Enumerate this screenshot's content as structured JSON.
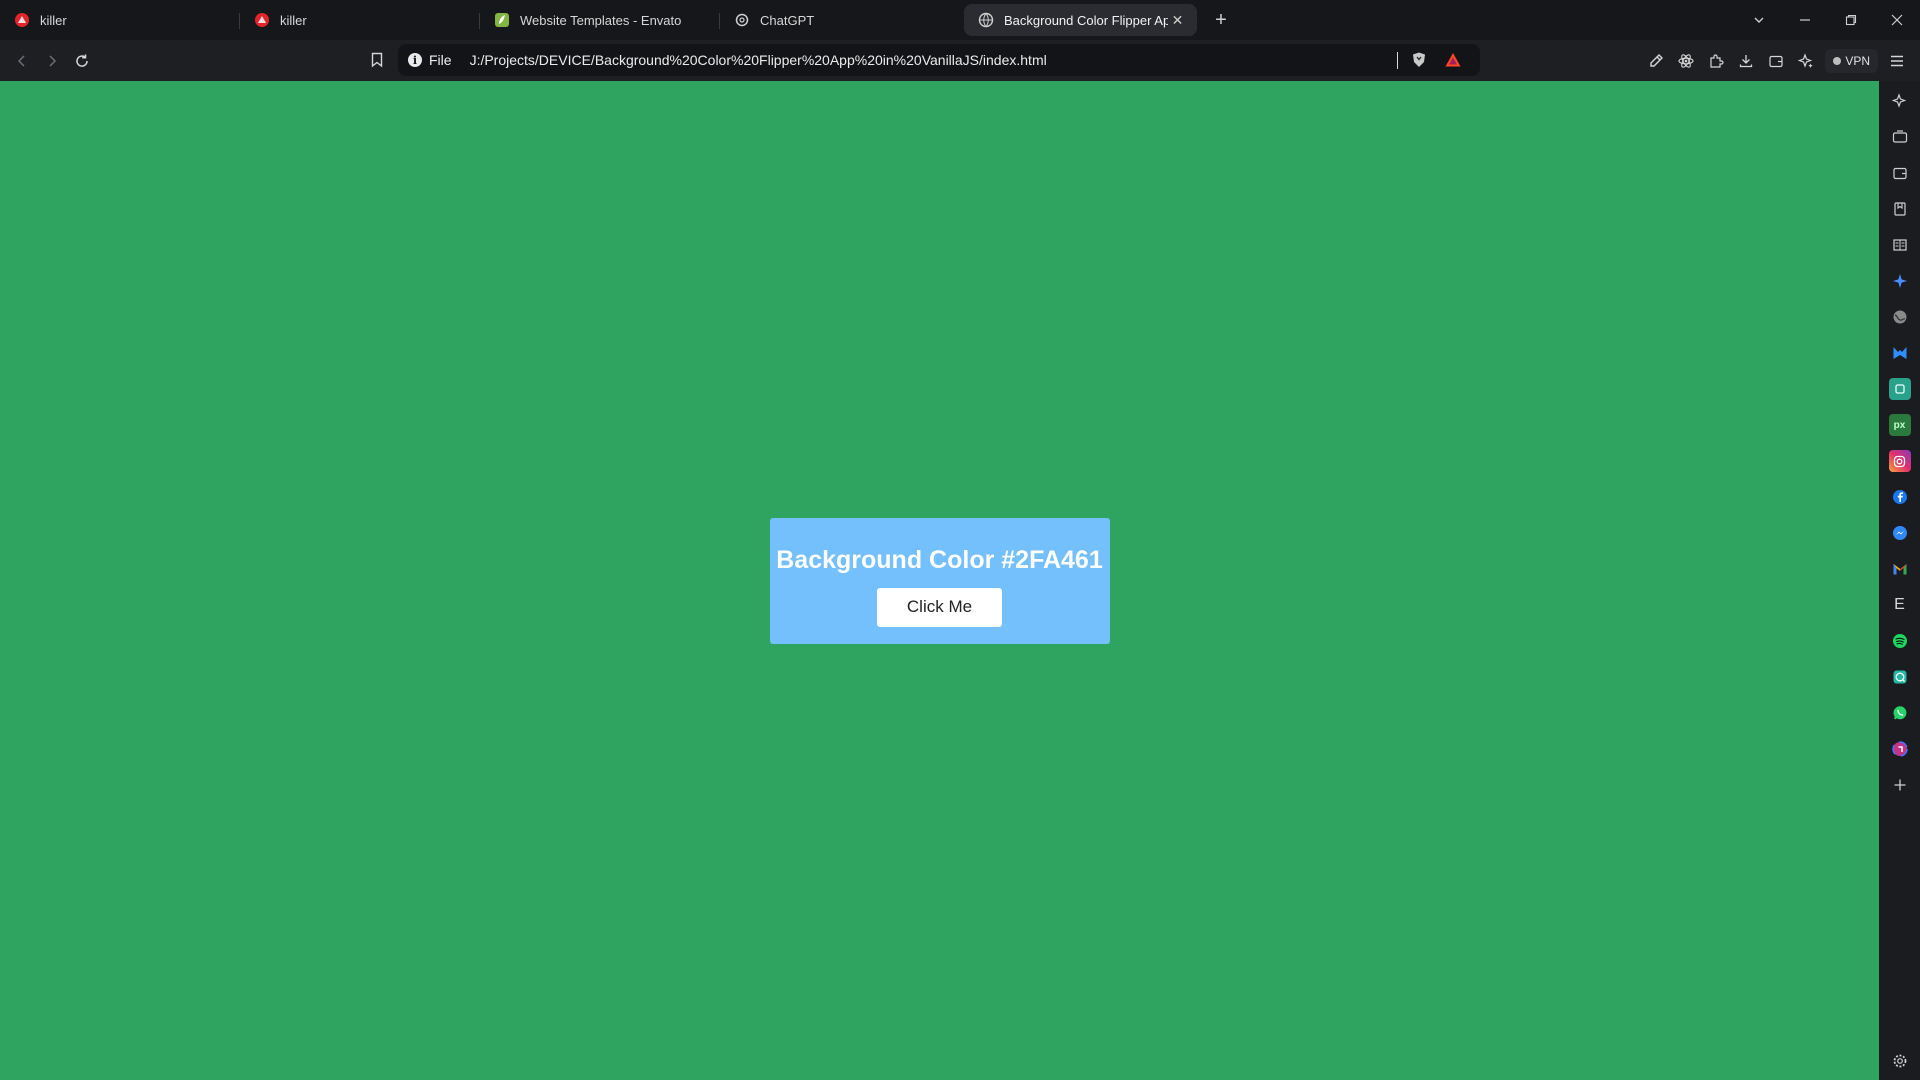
{
  "tabs": [
    {
      "title": "killer",
      "favicon": "brave-red-icon"
    },
    {
      "title": "killer",
      "favicon": "brave-red-icon"
    },
    {
      "title": "Website Templates - Envato",
      "favicon": "envato-icon"
    },
    {
      "title": "ChatGPT",
      "favicon": "chatgpt-icon"
    },
    {
      "title": "Background Color Flipper App",
      "favicon": "globe-icon",
      "active": true
    }
  ],
  "toolbar": {
    "scheme": "File",
    "url": "J:/Projects/DEVICE/Background%20Color%20Flipper%20App%20in%20VanillaJS/index.html",
    "vpn_label": "VPN"
  },
  "page": {
    "background_color": "#2FA461",
    "card_color": "#74C0FC",
    "heading": "Background Color #2FA461",
    "button_label": "Click Me"
  },
  "sidebar_icons": [
    "leo-star-icon",
    "video-icon",
    "wallet-icon",
    "bookmark-icon",
    "reading-list-icon",
    "sparkle-icon",
    "globe-icon",
    "malwarebytes-icon",
    "app-square-icon",
    "pixel-icon",
    "instagram-icon",
    "facebook-icon",
    "messenger-icon",
    "gmail-icon",
    "e-letter-icon",
    "spotify-icon",
    "chat-icon",
    "whatsapp-icon",
    "threads-icon",
    "add-icon"
  ]
}
